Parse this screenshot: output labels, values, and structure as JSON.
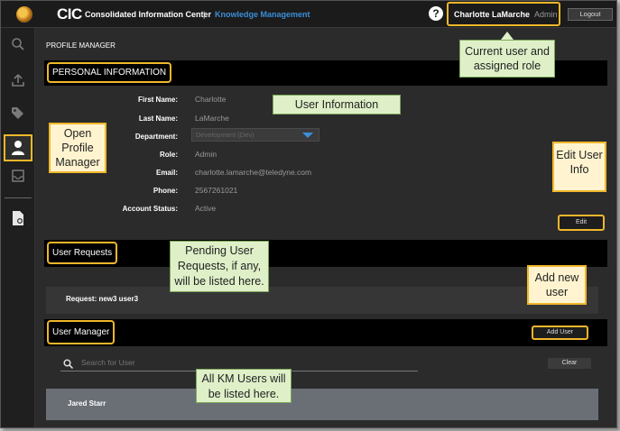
{
  "header": {
    "brand": "CIC",
    "brand_full": "Consolidated Information Center",
    "separator": "|",
    "module": "Knowledge Management",
    "help_icon": "?",
    "user_name": "Charlotte LaMarche",
    "user_role": "Admin",
    "logout_label": "Logout"
  },
  "page_title": "PROFILE MANAGER",
  "personal": {
    "section_title": "PERSONAL INFORMATION",
    "fields": [
      {
        "label": "First Name:",
        "value": "Charlotte"
      },
      {
        "label": "Last Name:",
        "value": "LaMarche"
      },
      {
        "label": "Department:",
        "value": "Development (Dev)"
      },
      {
        "label": "Role:",
        "value": "Admin"
      },
      {
        "label": "Email:",
        "value": "charlotte.lamarche@teledyne.com"
      },
      {
        "label": "Phone:",
        "value": "2567261021"
      },
      {
        "label": "Account Status:",
        "value": "Active"
      }
    ],
    "edit_label": "Edit"
  },
  "requests": {
    "section_title": "User Requests",
    "items": [
      {
        "label": "Request: new3 user3"
      }
    ]
  },
  "user_manager": {
    "section_title": "User Manager",
    "add_user_label": "Add User",
    "search_placeholder": "Search for User",
    "clear_label": "Clear",
    "users": [
      {
        "name": "Jared Starr"
      }
    ]
  },
  "callouts": {
    "user_info": "User Information",
    "current_user": "Current user and assigned role",
    "open_profile": "Open Profile Manager",
    "edit_info": "Edit User Info",
    "pending": "Pending User Requests, if any, will be listed here.",
    "add_new_user": "Add new user",
    "all_users": "All KM Users will be listed here."
  },
  "colors": {
    "highlight": "#f0b72a",
    "accent_blue": "#3a8fd8",
    "callout_green": "#dff0c8"
  }
}
